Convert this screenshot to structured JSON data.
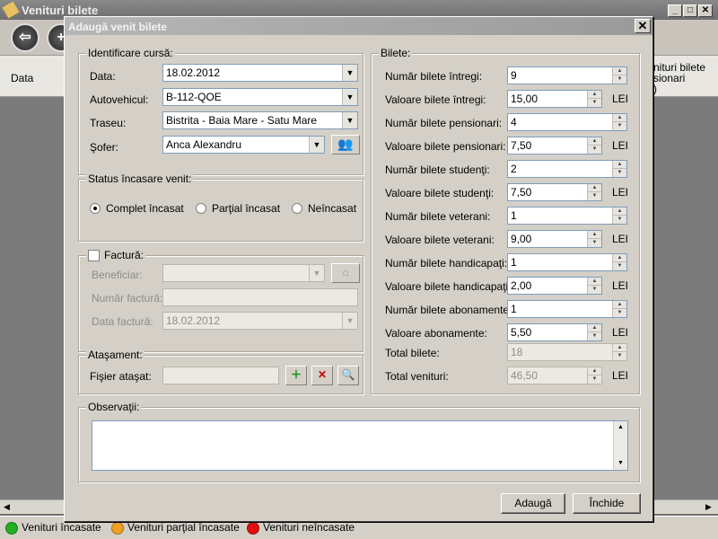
{
  "main": {
    "title": "Venituri bilete",
    "grid_header": {
      "col_data": "Data",
      "col_right_line1": "nituri bilete",
      "col_right_line2": "sionari",
      "col_right_line3": ")"
    },
    "legend": [
      {
        "label": "Venituri încasate",
        "color": "#22b022"
      },
      {
        "label": "Venituri parţial încasate",
        "color": "#f0a020"
      },
      {
        "label": "Venituri neîncasate",
        "color": "#e01010"
      }
    ]
  },
  "dialog": {
    "title": "Adaugă venit bilete",
    "identificare": {
      "legend": "Identificare cursă:",
      "data_label": "Data:",
      "data_value": "18.02.2012",
      "autovehicul_label": "Autovehicul:",
      "autovehicul_value": "B-112-QOE",
      "traseu_label": "Traseu:",
      "traseu_value": "Bistrita - Baia Mare - Satu Mare",
      "sofer_label": "Şofer:",
      "sofer_value": "Anca Alexandru"
    },
    "status": {
      "legend": "Status încasare venit:",
      "options": [
        "Complet încasat",
        "Parţial încasat",
        "Neîncasat"
      ],
      "selected": "Complet încasat"
    },
    "factura": {
      "legend": "Factură:",
      "checked": false,
      "beneficiar_label": "Beneficiar:",
      "beneficiar_value": "",
      "numar_label": "Număr factură:",
      "numar_value": "",
      "data_label": "Data factură:",
      "data_value": "18.02.2012"
    },
    "atasament": {
      "legend": "Ataşament:",
      "fisier_label": "Fişier ataşat:",
      "fisier_value": ""
    },
    "bilete": {
      "legend": "Bilete:",
      "currency": "LEI",
      "rows": [
        {
          "label": "Număr bilete întregi:",
          "value": "9",
          "lei": false
        },
        {
          "label": "Valoare bilete întregi:",
          "value": "15,00",
          "lei": true
        },
        {
          "label": "Număr bilete pensionari:",
          "value": "4",
          "lei": false
        },
        {
          "label": "Valoare bilete pensionari:",
          "value": "7,50",
          "lei": true
        },
        {
          "label": "Număr bilete studenţi:",
          "value": "2",
          "lei": false
        },
        {
          "label": "Valoare bilete studenţi:",
          "value": "7,50",
          "lei": true
        },
        {
          "label": "Număr bilete veterani:",
          "value": "1",
          "lei": false
        },
        {
          "label": "Valoare bilete veterani:",
          "value": "9,00",
          "lei": true
        },
        {
          "label": "Număr bilete handicapaţi:",
          "value": "1",
          "lei": false
        },
        {
          "label": "Valoare bilete handicapaţi:",
          "value": "2,00",
          "lei": true
        },
        {
          "label": "Număr bilete abonamente:",
          "value": "1",
          "lei": false
        },
        {
          "label": "Valoare abonamente:",
          "value": "5,50",
          "lei": true
        }
      ],
      "total_bilete_label": "Total bilete:",
      "total_bilete_value": "18",
      "total_venituri_label": "Total venituri:",
      "total_venituri_value": "46,50"
    },
    "observatii": {
      "legend": "Observaţii:",
      "value": ""
    },
    "buttons": {
      "adauga": "Adaugă",
      "inchide": "Închide"
    }
  }
}
